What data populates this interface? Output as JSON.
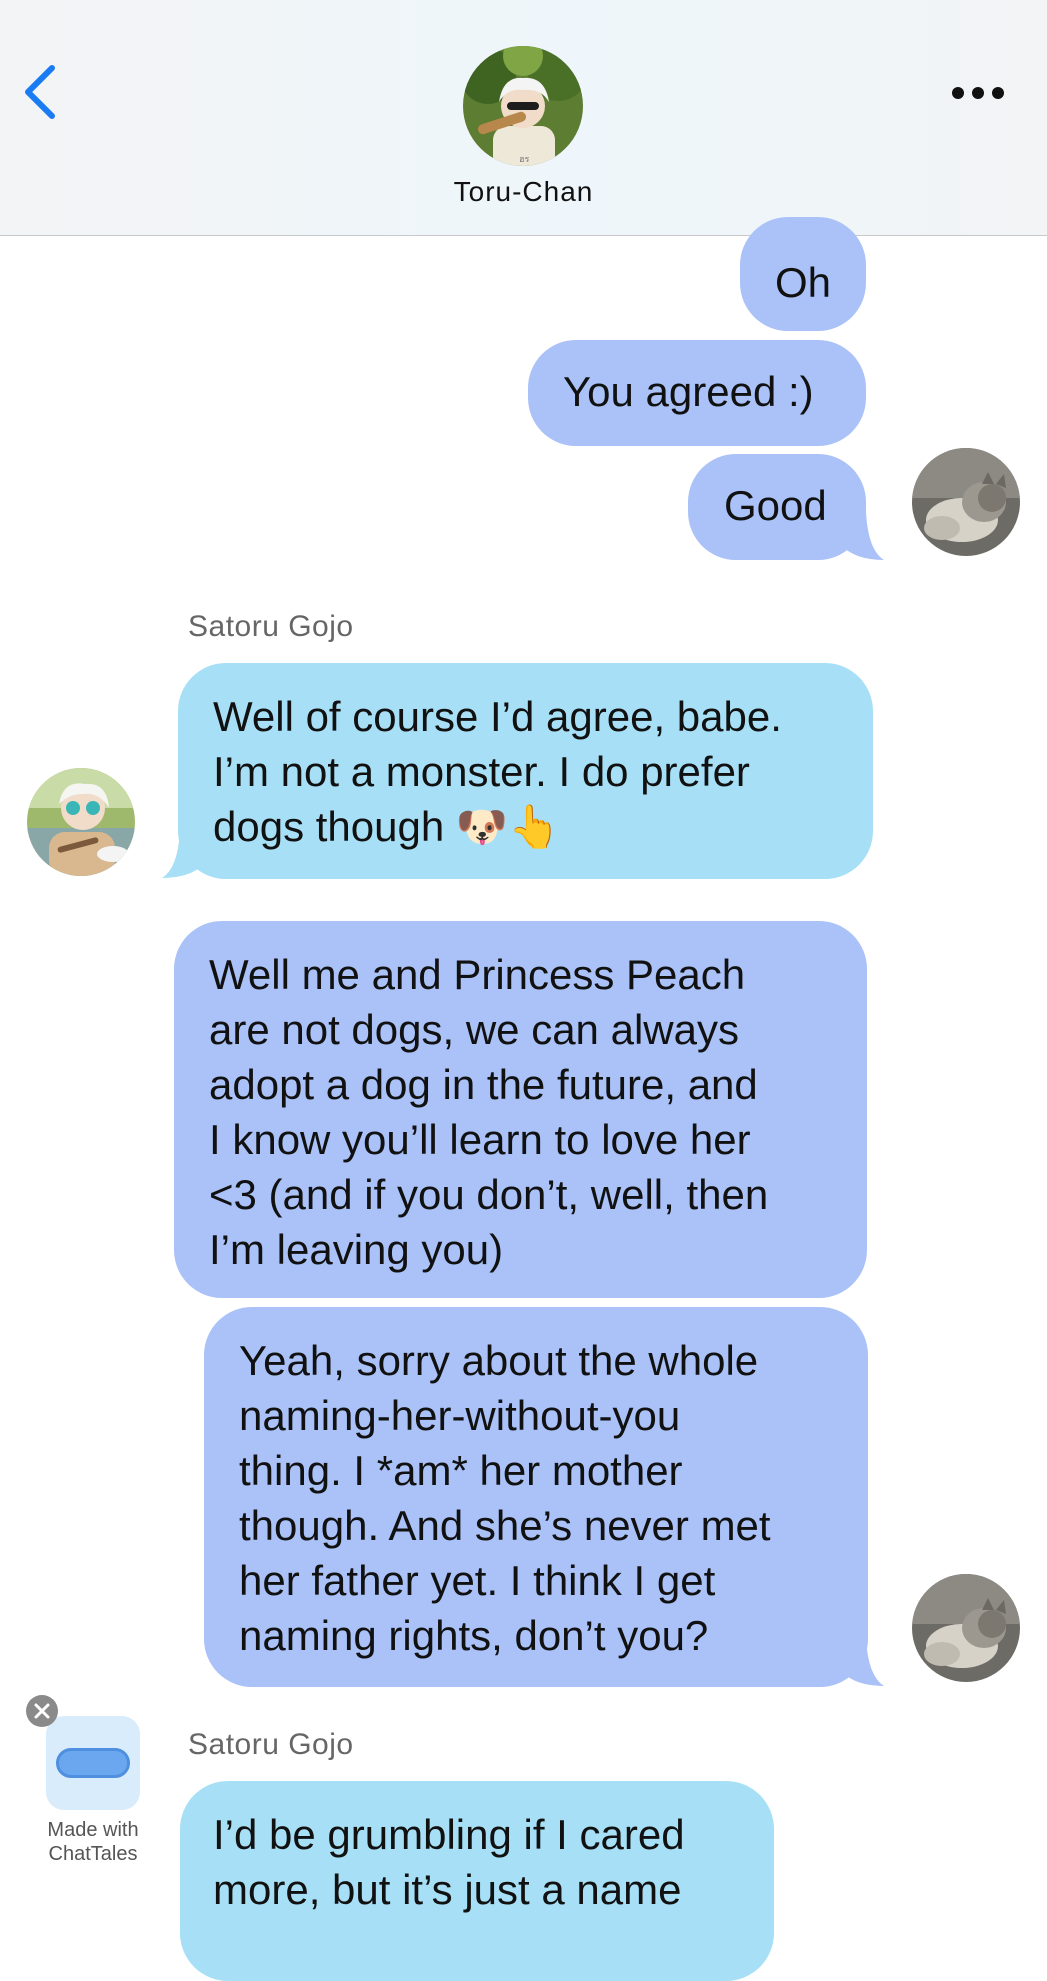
{
  "header": {
    "contact_name": "Toru-Chan",
    "back_icon": "chevron-left-icon",
    "more_icon": "ellipsis-icon"
  },
  "messages": [
    {
      "from": "me",
      "text": "Oh"
    },
    {
      "from": "me",
      "text": "You agreed :)"
    },
    {
      "from": "me",
      "text": "Good"
    },
    {
      "from": "them",
      "sender": "Satoru Gojo",
      "lines": [
        "Well of course I’d agree, babe.",
        "I’m not a monster. I do prefer",
        "dogs though 🐶👆"
      ]
    },
    {
      "from": "me",
      "lines": [
        "Well me and Princess Peach",
        "are not dogs, we can always",
        "adopt a dog in the future, and",
        "I know you’ll learn to love her",
        "<3 (and if you don’t, well, then",
        "I’m leaving you)"
      ]
    },
    {
      "from": "me",
      "lines": [
        "Yeah, sorry about the whole",
        "naming-her-without-you",
        "thing. I *am* her mother",
        "though. And she’s never met",
        "her father yet. I think I get",
        "naming rights, don’t you?"
      ]
    },
    {
      "from": "them",
      "sender": "Satoru Gojo",
      "lines": [
        "I’d be grumbling if I cared",
        "more, but it’s just a name"
      ]
    }
  ],
  "watermark": {
    "line1": "Made with",
    "line2": "ChatTales",
    "close_icon": "close-icon"
  },
  "colors": {
    "me_bubble": "#aac2f8",
    "them_bubble": "#a7e0f6",
    "accent": "#1a7cf2"
  }
}
